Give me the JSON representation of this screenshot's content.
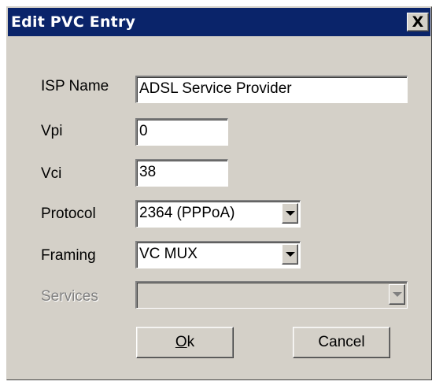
{
  "dialog": {
    "title": "Edit PVC Entry",
    "close_glyph": "X"
  },
  "fields": {
    "isp_name": {
      "label": "ISP Name",
      "value": "ADSL Service Provider"
    },
    "vpi": {
      "label": "Vpi",
      "value": "0"
    },
    "vci": {
      "label": "Vci",
      "value": "38"
    },
    "protocol": {
      "label": "Protocol",
      "value": "2364 (PPPoA)"
    },
    "framing": {
      "label": "Framing",
      "value": "VC MUX"
    },
    "services": {
      "label": "Services",
      "value": "",
      "disabled": true
    }
  },
  "buttons": {
    "ok_mnemonic": "O",
    "ok_rest": "k",
    "cancel": "Cancel"
  },
  "colors": {
    "titlebar": "#0a246a",
    "face": "#d4d0c8",
    "disabled_text": "#808080"
  },
  "icons": {
    "close": "close-icon",
    "dropdown": "chevron-down-icon"
  }
}
